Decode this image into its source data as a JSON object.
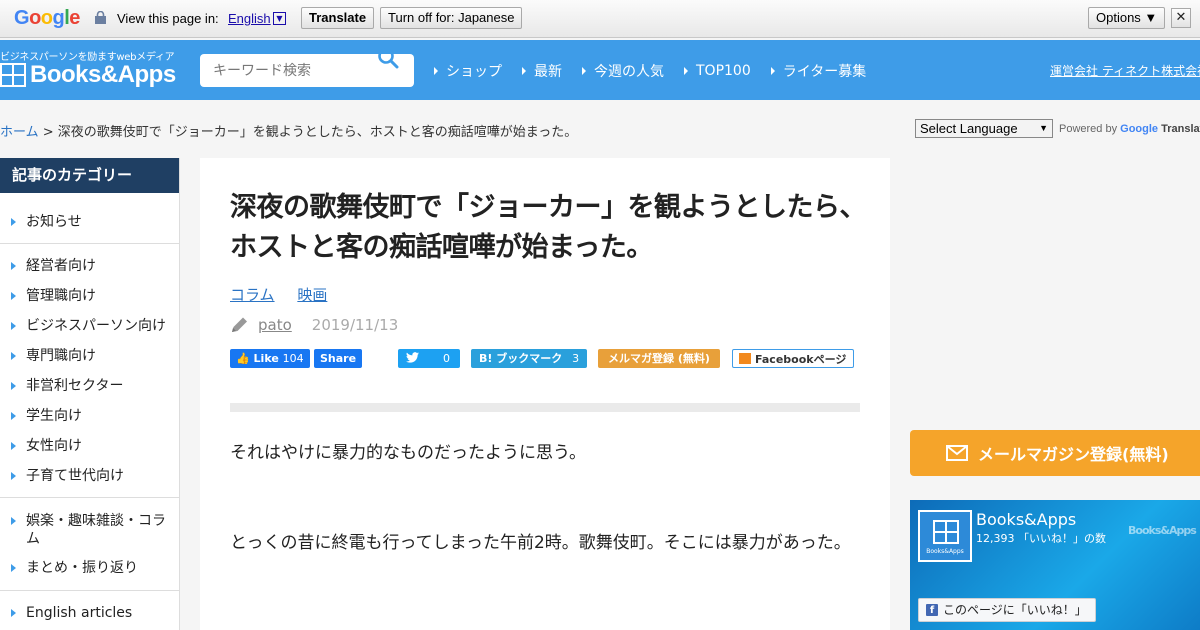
{
  "translate_bar": {
    "logo": "Google",
    "view_text": "View this page in:",
    "language": "English",
    "translate_label": "Translate",
    "turn_off_label": "Turn off for: Japanese",
    "options_label": "Options ▼",
    "close_label": "✕"
  },
  "header": {
    "tagline": "ビジネスパーソンを励ますwebメディア",
    "logo_text": "Books&Apps",
    "search_placeholder": "キーワード検索",
    "nav": [
      "ショップ",
      "最新",
      "今週の人気",
      "TOP100",
      "ライター募集"
    ],
    "company_link": "運営会社 ティネクト株式会社"
  },
  "breadcrumb": {
    "home": "ホーム",
    "separator": " > ",
    "current": "深夜の歌舞伎町で「ジョーカー」を観ようとしたら、ホストと客の痴話喧嘩が始まった。"
  },
  "language_select": {
    "selected": "Select Language",
    "powered_by": "Powered by",
    "google": "Google",
    "translate": "Translate"
  },
  "sidebar": {
    "heading": "記事のカテゴリー",
    "items": [
      "お知らせ",
      "経営者向け",
      "管理職向け",
      "ビジネスパーソン向け",
      "専門職向け",
      "非営利セクター",
      "学生向け",
      "女性向け",
      "子育て世代向け",
      "娯楽・趣味雑談・コラム",
      "まとめ・振り返り",
      "English articles"
    ]
  },
  "article": {
    "title": "深夜の歌舞伎町で「ジョーカー」を観ようとしたら、ホストと客の痴話喧嘩が始まった。",
    "categories": [
      "コラム",
      "映画"
    ],
    "author": "pato",
    "date": "2019/11/13",
    "share": {
      "fb_like": "Like",
      "fb_like_count": "104",
      "fb_share": "Share",
      "tw_count": "0",
      "hatena": "B! ブックマーク",
      "hatena_count": "3",
      "mailmag": "メルマガ登録 (無料)",
      "fb_page": "Facebookページ"
    },
    "paragraphs": [
      "それはやけに暴力的なものだったように思う。",
      "とっくの昔に終電も行ってしまった午前2時。歌舞伎町。そこには暴力があった。"
    ]
  },
  "right_column": {
    "mailmag_button": "メールマガジン登録(無料)",
    "fb_page_name": "Books&Apps",
    "fb_like_count": "12,393 「いいね！」の数",
    "fb_avatar_text": "Books&Apps",
    "fb_watermark": "Books&Apps",
    "fb_like_button": "このページに「いいね！」"
  },
  "colors": {
    "header_bg": "#3e9ce8",
    "sidebar_heading_bg": "#1f3f63",
    "link": "#2a73c4",
    "mail_button": "#f5a42a"
  }
}
